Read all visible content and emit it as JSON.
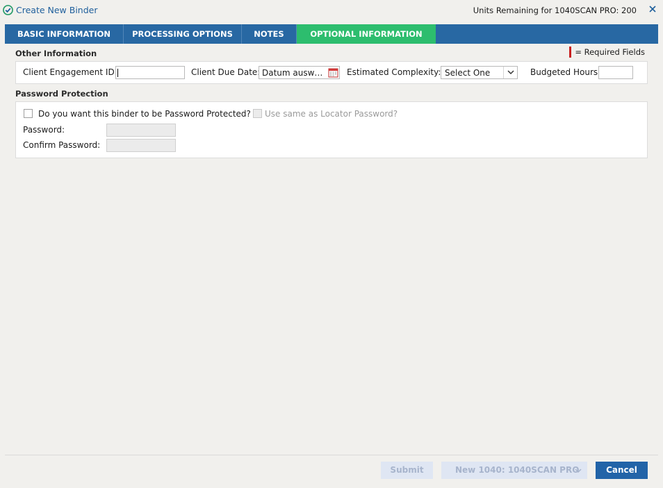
{
  "window": {
    "title": "Create New Binder",
    "units_remaining": "Units Remaining for 1040SCAN PRO: 200"
  },
  "tabs": [
    {
      "label": "BASIC INFORMATION",
      "active": false
    },
    {
      "label": "PROCESSING OPTIONS",
      "active": false
    },
    {
      "label": "NOTES",
      "active": false
    },
    {
      "label": "OPTIONAL INFORMATION",
      "active": true
    }
  ],
  "colors": {
    "tab_bar": "#2868a3",
    "active_tab": "#2dbd6e",
    "required_marker": "#c81e1e",
    "primary_button": "#2264a8"
  },
  "required_legend": "= Required Fields",
  "other_info": {
    "heading": "Other Information",
    "engagement_id_label": "Client Engagement ID:",
    "engagement_id_value": "",
    "due_date_label": "Client Due Date:",
    "due_date_value": "Datum ausw…",
    "complexity_label": "Estimated Complexity:",
    "complexity_value": "Select One",
    "budgeted_hours_label": "Budgeted Hours:",
    "budgeted_hours_value": ""
  },
  "password": {
    "heading": "Password Protection",
    "protect_question": "Do you want this binder to be Password Protected?",
    "protect_checked": false,
    "same_as_locator": "Use same as Locator Password?",
    "same_as_locator_checked": false,
    "password_label": "Password:",
    "confirm_label": "Confirm Password:"
  },
  "footer": {
    "submit_label": "Submit",
    "binder_type_label": "New 1040: 1040SCAN PRO",
    "cancel_label": "Cancel"
  }
}
